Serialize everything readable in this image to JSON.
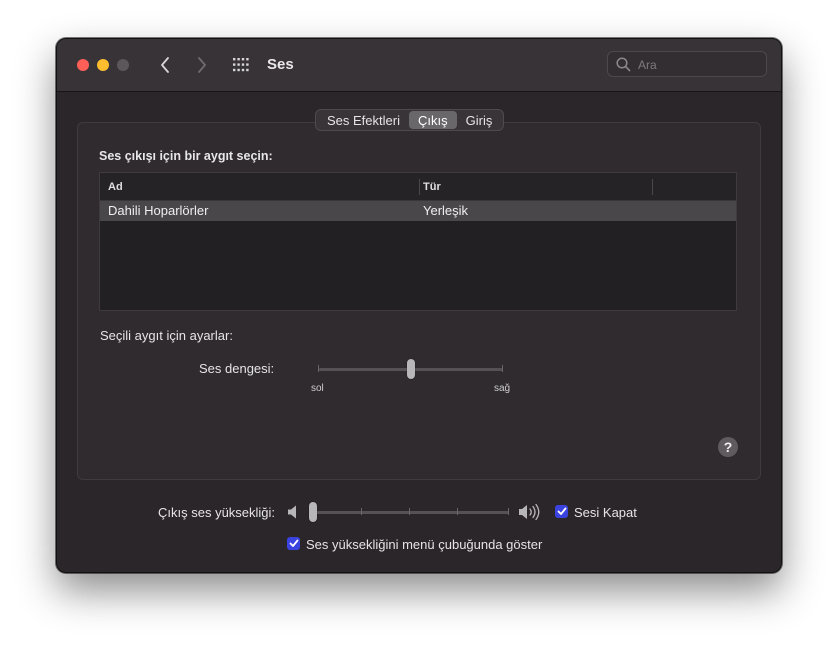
{
  "window": {
    "title": "Ses"
  },
  "search": {
    "placeholder": "Ara"
  },
  "tabs": [
    {
      "label": "Ses Efektleri",
      "selected": false
    },
    {
      "label": "Çıkış",
      "selected": true
    },
    {
      "label": "Giriş",
      "selected": false
    }
  ],
  "output": {
    "section_title": "Ses çıkışı için bir aygıt seçin:",
    "columns": [
      "Ad",
      "Tür"
    ],
    "devices": [
      {
        "name": "Dahili Hoparlörler",
        "type": "Yerleşik",
        "selected": true
      }
    ],
    "settings_label": "Seçili aygıt için ayarlar:",
    "balance": {
      "label": "Ses dengesi:",
      "left_label": "sol",
      "right_label": "sağ",
      "value": 0.5
    }
  },
  "volume": {
    "label": "Çıkış ses yüksekliği:",
    "value": 0.0,
    "mute_label": "Sesi Kapat",
    "mute_checked": true,
    "show_in_menubar_label": "Ses yüksekliğini menü çubuğunda göster",
    "show_in_menubar_checked": true
  },
  "help": {
    "label": "?"
  },
  "colors": {
    "window_bg": "#2a2629",
    "titlebar_bg": "#373337",
    "close": "#ff5f57",
    "minimize": "#febc2e",
    "checkbox_accent": "#3a43e0",
    "selection_row": "#4a474a"
  },
  "icons": [
    "chevron-left-icon",
    "chevron-right-icon",
    "grid-icon",
    "search-icon",
    "speaker-low-icon",
    "speaker-high-icon",
    "checkmark-icon",
    "help-icon"
  ]
}
